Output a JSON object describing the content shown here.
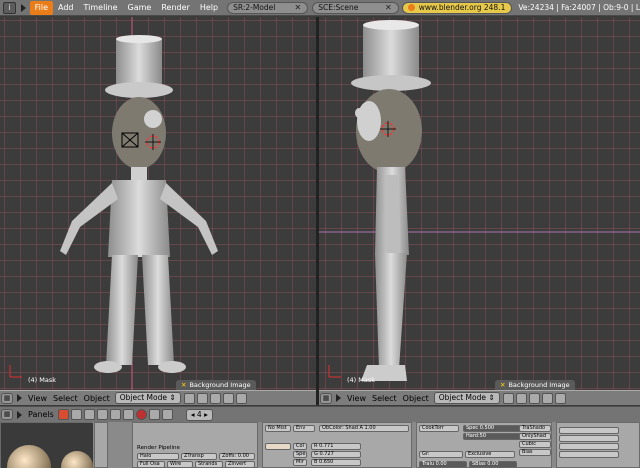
{
  "topbar": {
    "info_icon": "i",
    "menus": [
      "File",
      "Add",
      "Timeline",
      "Game",
      "Render",
      "Help"
    ],
    "active_menu": "File",
    "screen_field": "SR:2-Model",
    "scene_field": "SCE:Scene",
    "url": "www.blender.org 248.1",
    "stats": "Ve:24234 | Fa:24007 | Ob:9-0 | L"
  },
  "viewport_left": {
    "label": "(4) Mask",
    "bg_image": "Background Image"
  },
  "viewport_right": {
    "label": "(4) Mask",
    "bg_image": "Background Image"
  },
  "header_left": {
    "menus": [
      "View",
      "Select",
      "Object"
    ],
    "mode": "Object Mode"
  },
  "header_right": {
    "menus": [
      "View",
      "Select",
      "Object"
    ],
    "mode": "Object Mode"
  },
  "buttons_header": {
    "panels_label": "Panels",
    "frame": "4"
  },
  "buttons": {
    "render_pipeline": "Render Pipeline",
    "halo": "Halo",
    "ztransp": "ZTransp",
    "zoffs": "Zoffs: 0.00",
    "fullosa": "Full Osa",
    "wire": "Wire",
    "strands": "Strands",
    "zinvert": "ZInvert",
    "col": "Col",
    "spe": "Spe",
    "mir": "Mir",
    "r": "R 0.771",
    "g": "G 0.727",
    "b": "B 0.650",
    "no_mist": "No Mist",
    "env": "Env",
    "obcolor": "ObColor: Shad A 1.00",
    "cooktorr": "CookTorr",
    "spec": "Spec 0.500",
    "hard": "Hard:50",
    "exclusive": "Exclusive",
    "grr": "Gr:",
    "tralu": "Tralu 0.00",
    "sbias": "SBias 0.00",
    "trashado": "TraShado",
    "onlyshad": "OnlyShad",
    "cubic": "Cubic",
    "bias": "Bias"
  },
  "colors": {
    "active_menu": "#e87d1a",
    "grid_line": "#c0606e",
    "grid_bg": "#3c3c3c",
    "url_field": "#e6c84a"
  }
}
